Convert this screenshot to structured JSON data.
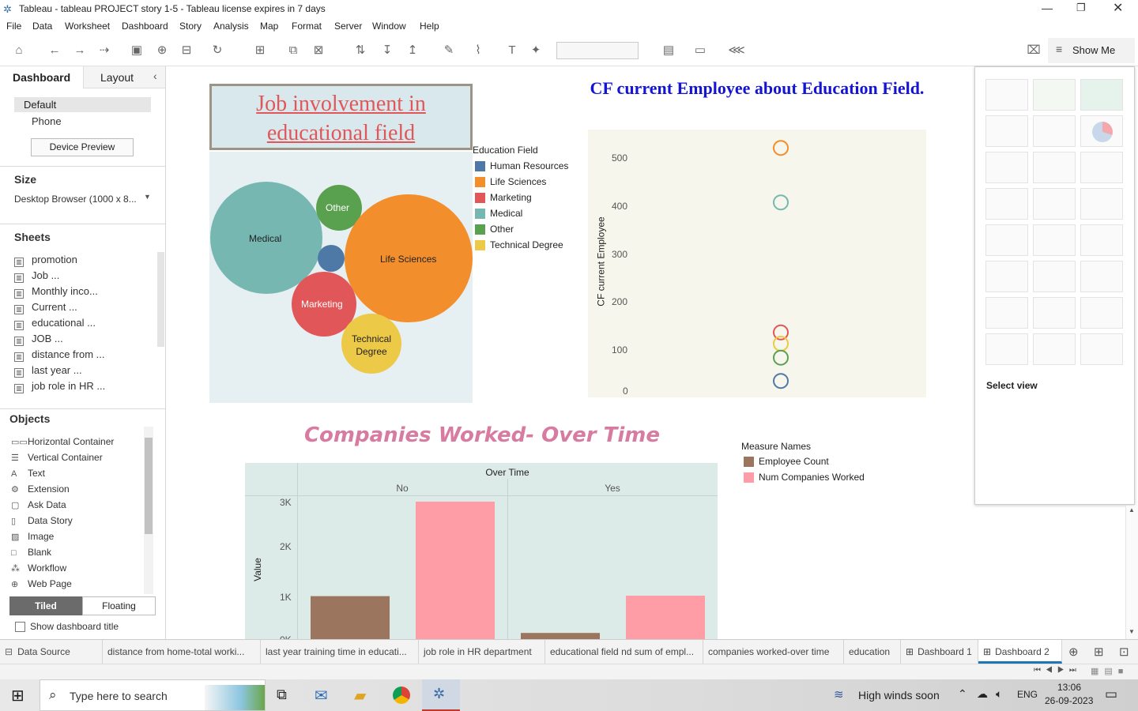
{
  "window": {
    "title": "Tableau - tableau PROJECT story 1-5 - Tableau license expires in 7 days"
  },
  "menu": [
    "File",
    "Data",
    "Worksheet",
    "Dashboard",
    "Story",
    "Analysis",
    "Map",
    "Format",
    "Server",
    "Window",
    "Help"
  ],
  "toolbar": {
    "show_me": "Show Me"
  },
  "left_panel": {
    "tabs": {
      "dashboard": "Dashboard",
      "layout": "Layout"
    },
    "devices": {
      "default": "Default",
      "phone": "Phone",
      "preview_button": "Device Preview"
    },
    "size": {
      "heading": "Size",
      "value": "Desktop Browser (1000 x 8..."
    },
    "sheets": {
      "heading": "Sheets",
      "items": [
        "promotion",
        "Job ...",
        "Monthly inco...",
        "Current ...",
        "educational ...",
        "JOB ...",
        "distance from ...",
        "last year ...",
        "job role in HR ..."
      ]
    },
    "objects": {
      "heading": "Objects",
      "items": [
        "Horizontal Container",
        "Vertical Container",
        "Text",
        "Extension",
        "Ask Data",
        "Data Story",
        "Image",
        "Blank",
        "Workflow",
        "Web Page"
      ]
    },
    "layout_mode": {
      "tiled": "Tiled",
      "floating": "Floating"
    },
    "show_title": "Show dashboard title"
  },
  "dashboard": {
    "bubble_title": "Job involvement in educational field",
    "legend": {
      "title": "Education Field",
      "items": [
        {
          "label": "Human Resources",
          "color": "#4e79a7"
        },
        {
          "label": "Life Sciences",
          "color": "#f28e2b"
        },
        {
          "label": "Marketing",
          "color": "#e15759"
        },
        {
          "label": "Medical",
          "color": "#76b7b2"
        },
        {
          "label": "Other",
          "color": "#59a14f"
        },
        {
          "label": "Technical Degree",
          "color": "#edc948"
        }
      ]
    },
    "bubbles": [
      "Medical",
      "Other",
      "Life Sciences",
      "Marketing",
      "Technical Degree"
    ],
    "scatter_title": "CF current Employee about Education Field.",
    "scatter_ylabel": "CF current Employee",
    "scatter_ticks": [
      "500",
      "400",
      "300",
      "200",
      "100",
      "0"
    ],
    "bar_title": "Companies Worked- Over Time",
    "bar_header": "Over Time",
    "bar_panels": [
      "No",
      "Yes"
    ],
    "bar_ylabel": "Value",
    "bar_ticks": [
      "3K",
      "2K",
      "1K",
      "0K"
    ],
    "measure_legend": {
      "title": "Measure Names",
      "items": [
        {
          "label": "Employee Count",
          "color": "#9c755f"
        },
        {
          "label": "Num Companies Worked",
          "color": "#ff9da7"
        }
      ]
    }
  },
  "chart_data": [
    {
      "type": "scatter",
      "title": "CF current Employee about Education Field.",
      "ylabel": "CF current Employee",
      "ylim": [
        0,
        520
      ],
      "series": [
        {
          "name": "Life Sciences",
          "values": [
            520
          ]
        },
        {
          "name": "Medical",
          "values": [
            403
          ]
        },
        {
          "name": "Marketing",
          "values": [
            124
          ]
        },
        {
          "name": "Technical Degree",
          "values": [
            100
          ]
        },
        {
          "name": "Other",
          "values": [
            70
          ]
        },
        {
          "name": "Human Resources",
          "values": [
            20
          ]
        }
      ]
    },
    {
      "type": "bar",
      "title": "Companies Worked- Over Time",
      "xlabel": "Over Time",
      "ylabel": "Value",
      "ylim": [
        0,
        3000
      ],
      "categories": [
        "No",
        "Yes"
      ],
      "series": [
        {
          "name": "Employee Count",
          "values": [
            1050,
            290
          ]
        },
        {
          "name": "Num Companies Worked",
          "values": [
            3000,
            1060
          ]
        }
      ]
    }
  ],
  "show_me": {
    "select_view": "Select view"
  },
  "sheet_tabs": [
    "Data Source",
    "distance from home-total worki...",
    "last year training time in educati...",
    "job role in HR department",
    "educational field nd sum of empl...",
    "companies worked-over time",
    "education",
    "Dashboard 1",
    "Dashboard 2"
  ],
  "taskbar": {
    "search_placeholder": "Type here to search",
    "weather": "High winds soon",
    "lang": "ENG",
    "time": "13:06",
    "date": "26-09-2023"
  }
}
